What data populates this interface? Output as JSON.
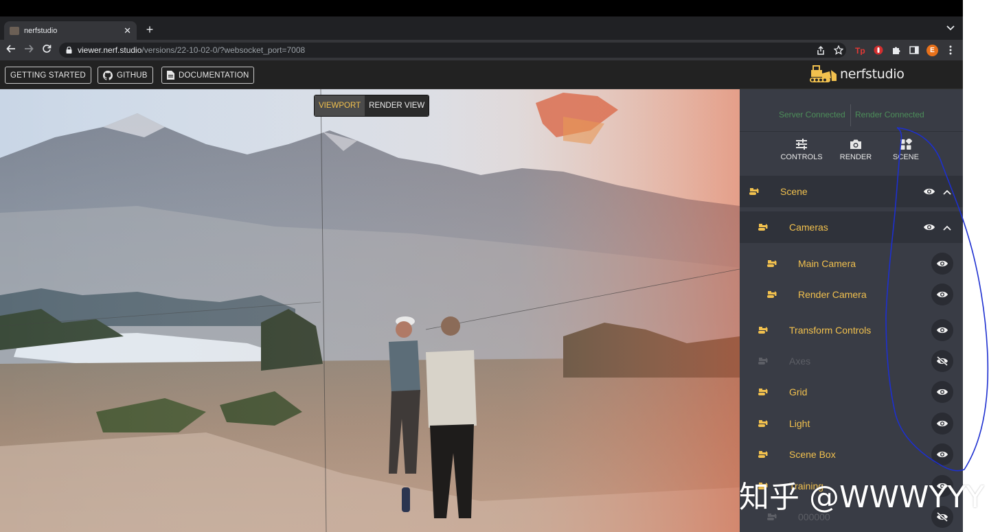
{
  "browser": {
    "tab": {
      "title": "nerfstudio",
      "close": "✕",
      "favicon": "nerfstudio-favicon"
    },
    "new_tab": "+",
    "tab_menu": "⌄",
    "url_host": "viewer.nerf.studio",
    "url_path": "/versions/22-10-02-0/?websocket_port=7008",
    "profile_initial": "E",
    "icons": [
      "back-icon",
      "forward-icon",
      "reload-icon",
      "lock-icon",
      "share-icon",
      "star-icon",
      "extension-red-icon",
      "extension-shield-icon",
      "puzzle-icon",
      "sidepanel-icon",
      "menu-icon"
    ]
  },
  "header": {
    "getting_started": "GETTING STARTED",
    "github": "GITHUB",
    "documentation": "DOCUMENTATION",
    "logo_text": "nerfstudio"
  },
  "viewport": {
    "toggle": {
      "viewport": "VIEWPORT",
      "render_view": "RENDER VIEW",
      "active": "viewport"
    }
  },
  "sidebar": {
    "status": {
      "server": "Server Connected",
      "render": "Render Connected"
    },
    "tabs": [
      {
        "label": "CONTROLS",
        "icon": "sliders-icon"
      },
      {
        "label": "RENDER",
        "icon": "camera-icon"
      },
      {
        "label": "SCENE",
        "icon": "grid-icon"
      }
    ],
    "active_tab": "SCENE",
    "tree": [
      {
        "label": "Scene",
        "level": 0,
        "visible": true,
        "expanded": true
      },
      {
        "label": "Cameras",
        "level": 1,
        "visible": true,
        "expanded": true
      },
      {
        "label": "Main Camera",
        "level": 2,
        "visible": true
      },
      {
        "label": "Render Camera",
        "level": 2,
        "visible": true
      },
      {
        "label": "Transform Controls",
        "level": 1,
        "visible": true
      },
      {
        "label": "Axes",
        "level": 1,
        "visible": false
      },
      {
        "label": "Grid",
        "level": 1,
        "visible": true
      },
      {
        "label": "Light",
        "level": 1,
        "visible": true
      },
      {
        "label": "Scene Box",
        "level": 1,
        "visible": true
      },
      {
        "label": "Training",
        "level": 1,
        "visible": true
      },
      {
        "label": "000000",
        "level": 2,
        "visible": false
      }
    ]
  },
  "watermark": "知乎 @WWWYYY",
  "colors": {
    "accent": "#f2c14e",
    "connected": "#4d8f5a",
    "panel": "#393c45",
    "pen": "#1d2fd0"
  }
}
